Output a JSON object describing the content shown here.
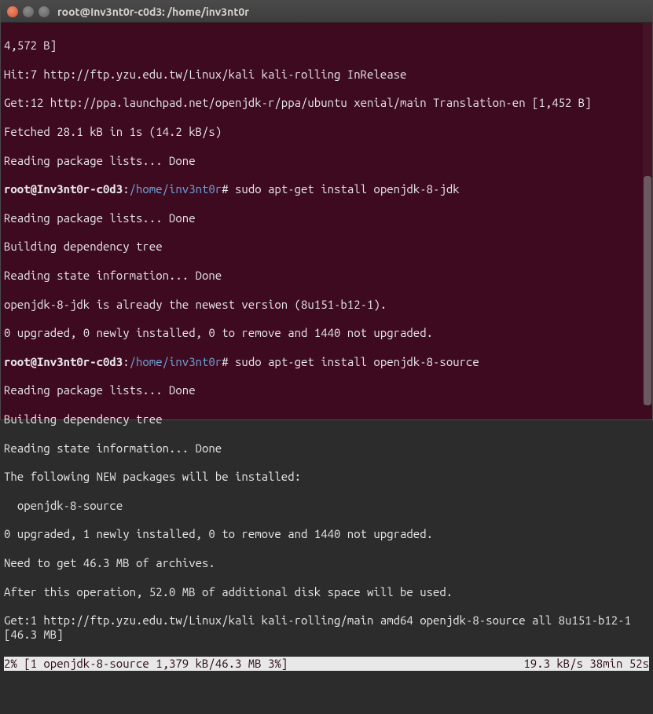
{
  "titlebar": {
    "title": "root@Inv3nt0r-c0d3: /home/inv3nt0r"
  },
  "prompt": {
    "user_host": "root@Inv3nt0r-c0d3",
    "sep": ":",
    "path": "/home/inv3nt0r",
    "end": "#"
  },
  "commands": {
    "install_jdk": "sudo apt-get install openjdk-8-jdk",
    "install_src": "sudo apt-get install openjdk-8-source"
  },
  "lines": {
    "l1": "4,572 B]",
    "l2": "Hit:7 http://ftp.yzu.edu.tw/Linux/kali kali-rolling InRelease",
    "l3": "Get:12 http://ppa.launchpad.net/openjdk-r/ppa/ubuntu xenial/main Translation-en [1,452 B]",
    "l4": "Fetched 28.1 kB in 1s (14.2 kB/s)",
    "l5": "Reading package lists... Done",
    "l6": "Reading package lists... Done",
    "l7": "Building dependency tree",
    "l8": "Reading state information... Done",
    "l9": "openjdk-8-jdk is already the newest version (8u151-b12-1).",
    "l10": "0 upgraded, 0 newly installed, 0 to remove and 1440 not upgraded.",
    "l11": "Reading package lists... Done",
    "l12": "Building dependency tree",
    "l13": "Reading state information... Done",
    "l14": "The following NEW packages will be installed:",
    "l15": "  openjdk-8-source",
    "l16": "0 upgraded, 1 newly installed, 0 to remove and 1440 not upgraded.",
    "l17": "Need to get 46.3 MB of archives.",
    "l18": "After this operation, 52.0 MB of additional disk space will be used.",
    "l19": "Get:1 http://ftp.yzu.edu.tw/Linux/kali kali-rolling/main amd64 openjdk-8-source all 8u151-b12-1 [46.3 MB]"
  },
  "progress": {
    "left": "2% [1 openjdk-8-source 1,379 kB/46.3 MB 3%]",
    "right": "19.3 kB/s 38min 52s"
  }
}
